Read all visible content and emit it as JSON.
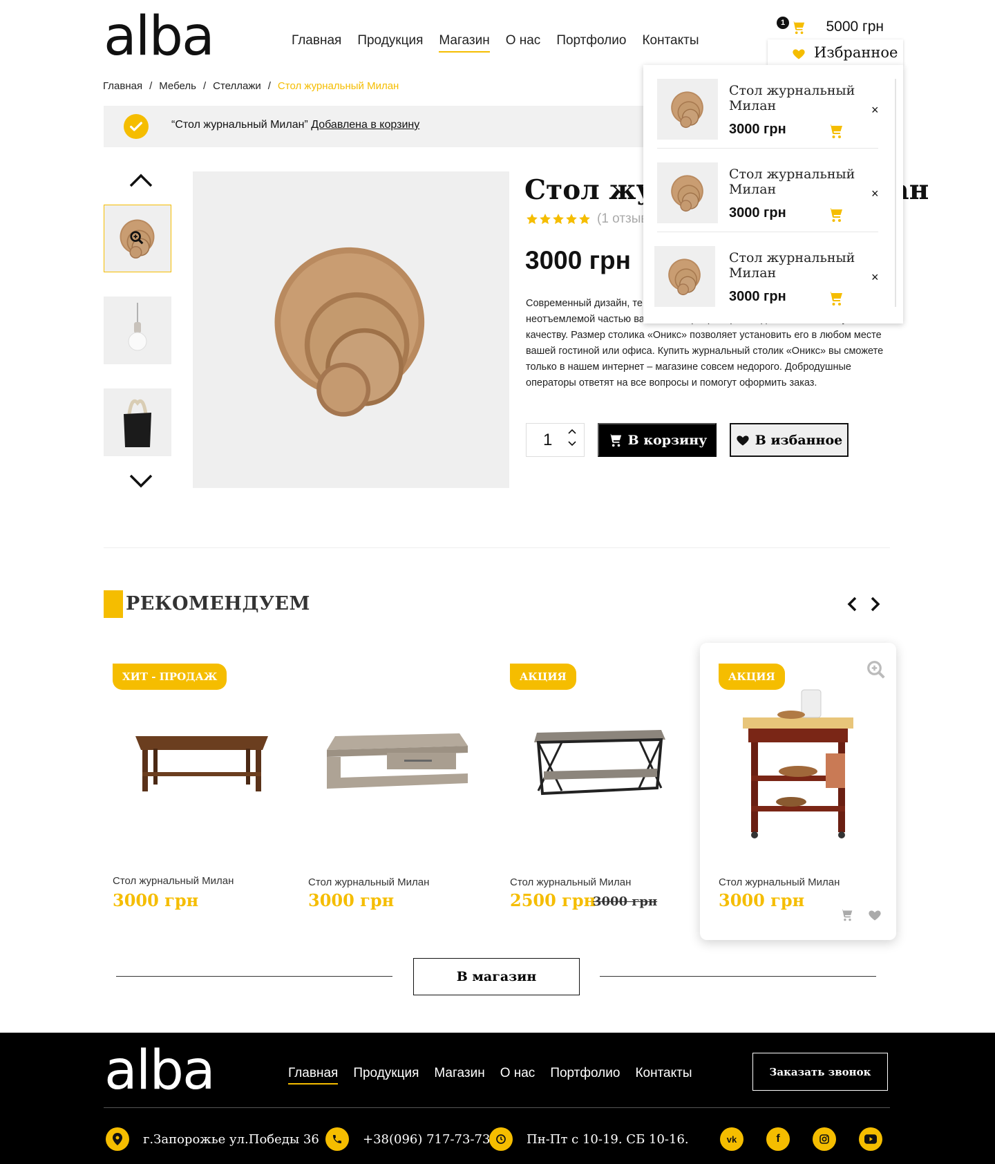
{
  "brand": {
    "logo": "alba",
    "accent": "#f5bd00"
  },
  "nav": [
    "Главная",
    "Продукция",
    "Магазин",
    "О нас",
    "Портфолио",
    "Контакты"
  ],
  "nav_active": "Магазин",
  "cart": {
    "count": "1",
    "total": "5000 грн"
  },
  "favorites": {
    "label": "Избранное",
    "items": [
      {
        "name": "Стол журнальный Милан",
        "price": "3000 грн",
        "remove": "×"
      },
      {
        "name": "Стол журнальный Милан",
        "price": "3000 грн",
        "remove": "×"
      },
      {
        "name": "Стол журнальный Милан",
        "price": "3000 грн",
        "remove": "×"
      }
    ]
  },
  "breadcrumb": {
    "items": [
      "Главная",
      "Мебель",
      "Стеллажи"
    ],
    "current": "Стол журнальный Милан",
    "separator": "/"
  },
  "notice": {
    "product": "“Стол журнальный Милан”",
    "link": "Добавлена в корзину"
  },
  "product": {
    "title": "Стол журнальный Милан",
    "rating": 5,
    "reviews": "(1 отзыв)",
    "price": "3000 грн",
    "description": "Современный дизайн, теплые тона и натуральные материалы станут неотъемлемой частью вашего интерьера. Цена изделия соответствует качеству. Размер столика «Оникс» позволяет установить его в любом месте вашей гостиной или офиса. Купить журнальный столик «Оникс» вы сможете только в нашем интернет – магазине совсем недорого. Добродушные операторы ответят на все вопросы и помогут оформить заказ.",
    "quantity": "1",
    "add_to_cart": "В корзину",
    "add_to_fav": "В избанное"
  },
  "recommend": {
    "title": "РЕКОМЕНДУЕМ",
    "cards": [
      {
        "badge": "ХИТ - ПРОДАЖ",
        "name": "Стол журнальный Милан",
        "price": "3000 грн",
        "old_price": ""
      },
      {
        "badge": "",
        "name": "Стол журнальный Милан",
        "price": "3000 грн",
        "old_price": ""
      },
      {
        "badge": "АКЦИЯ",
        "name": "Стол журнальный Милан",
        "price": "2500 грн",
        "old_price": "3000 грн"
      },
      {
        "badge": "АКЦИЯ",
        "name": "Стол журнальный Милан",
        "price": "3000 грн",
        "old_price": ""
      }
    ],
    "shop_button": "В магазин"
  },
  "footer": {
    "logo": "alba",
    "nav": [
      "Главная",
      "Продукция",
      "Магазин",
      "О нас",
      "Портфолио",
      "Контакты"
    ],
    "nav_active": "Главная",
    "call_button": "Заказать звонок",
    "address": "г.Запорожье ул.Победы 36",
    "phone": "+38(096) 717-73-73",
    "hours": "Пн-Пт с 10-19. СБ 10-16.",
    "socials": [
      "vk-icon",
      "facebook-icon",
      "instagram-icon",
      "youtube-icon"
    ]
  }
}
